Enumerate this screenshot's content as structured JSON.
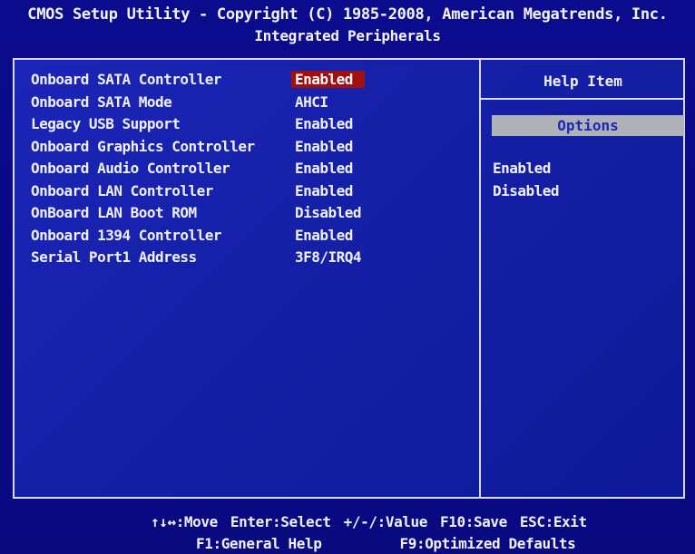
{
  "header": {
    "title": "CMOS Setup Utility - Copyright (C) 1985-2008, American Megatrends, Inc.",
    "subtitle": "Integrated Peripherals"
  },
  "settings": [
    {
      "label": "Onboard SATA Controller",
      "value": "Enabled",
      "selected": true
    },
    {
      "label": "Onboard SATA Mode",
      "value": "AHCI",
      "selected": false
    },
    {
      "label": "Legacy USB Support",
      "value": "Enabled",
      "selected": false
    },
    {
      "label": "Onboard Graphics Controller",
      "value": "Enabled",
      "selected": false
    },
    {
      "label": "Onboard Audio Controller",
      "value": "Enabled",
      "selected": false
    },
    {
      "label": "Onboard LAN Controller",
      "value": "Enabled",
      "selected": false
    },
    {
      "label": "OnBoard LAN Boot ROM",
      "value": "Disabled",
      "selected": false
    },
    {
      "label": "Onboard 1394 Controller",
      "value": "Enabled",
      "selected": false
    },
    {
      "label": "Serial Port1 Address",
      "value": "3F8/IRQ4",
      "selected": false
    }
  ],
  "help": {
    "title": "Help Item",
    "options_label": "Options",
    "options": [
      "Enabled",
      "Disabled"
    ]
  },
  "footer": {
    "row1": [
      "↑↓↔:Move",
      "Enter:Select",
      "+/-/:Value",
      "F10:Save",
      "ESC:Exit"
    ],
    "row2": [
      "F1:General Help",
      "F9:Optimized Defaults"
    ]
  },
  "colors": {
    "background": "#0a0a8a",
    "panel": "#1520a8",
    "selected": "#a01010",
    "options_bar": "#b0b0b8"
  }
}
